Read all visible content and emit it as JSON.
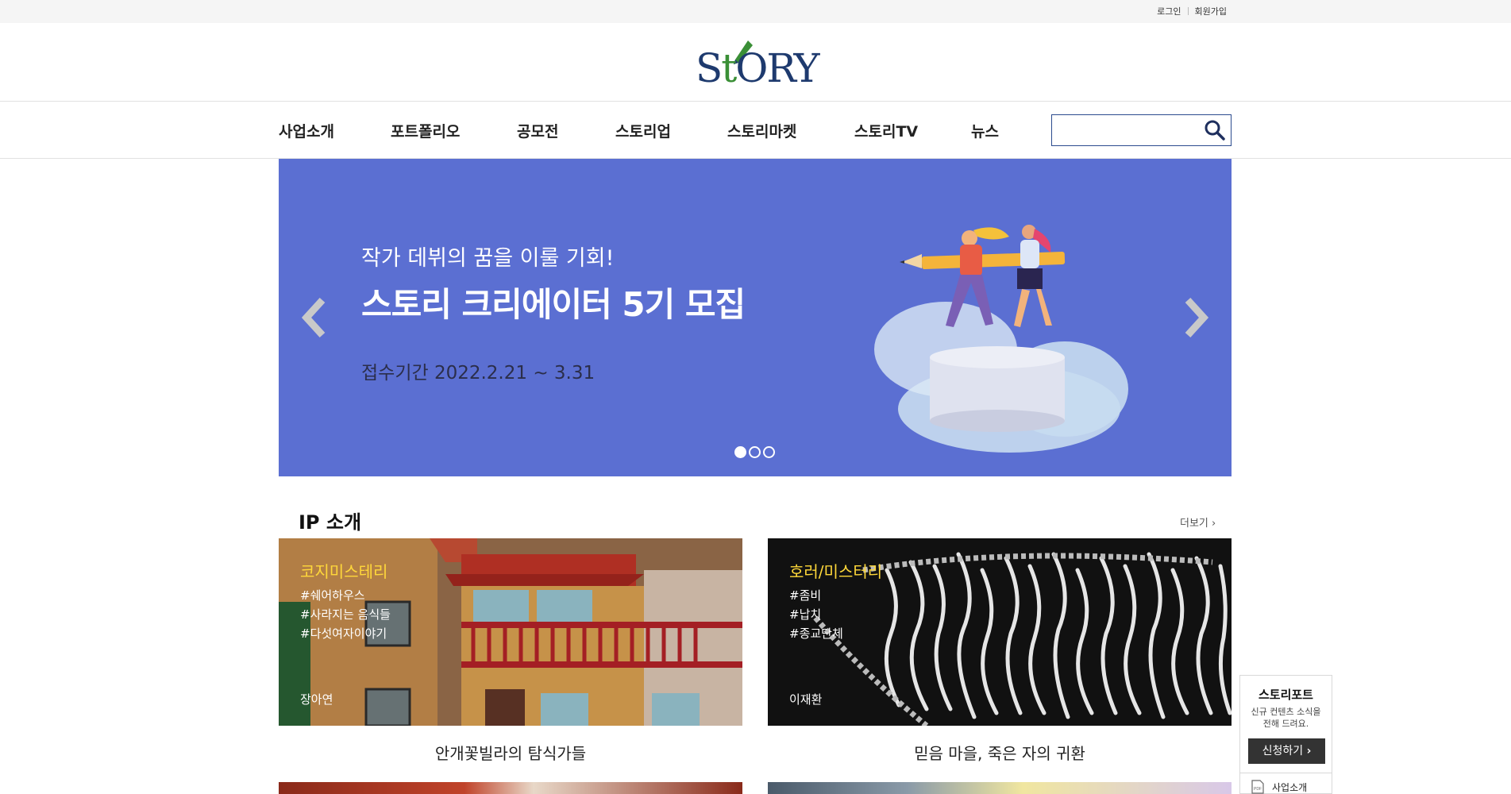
{
  "top_links": {
    "login": "로그인",
    "signup": "회원가입"
  },
  "logo": {
    "text_prefix": "S",
    "text_t": "t",
    "text_suffix": "ORY"
  },
  "nav": {
    "items": [
      "사업소개",
      "포트폴리오",
      "공모전",
      "스토리업",
      "스토리마켓",
      "스토리TV",
      "뉴스"
    ],
    "search_value": ""
  },
  "banner": {
    "subtitle": "작가 데뷔의 꿈을 이룰 기회!",
    "title": "스토리 크리에이터 5기 모집",
    "period": "접수기간 2022.2.21 ~ 3.31",
    "slide_count": 3,
    "active_slide": 1,
    "bg_color": "#5b6fd2"
  },
  "ip_section": {
    "title": "IP 소개",
    "more": "더보기 ›",
    "cards": [
      {
        "genre": "코지미스테리",
        "tags": [
          "#쉐어하우스",
          "#사라지는 음식들",
          "#다섯여자이야기"
        ],
        "author": "장아연",
        "title": "안개꽃빌라의 탐식가들"
      },
      {
        "genre": "호러/미스터리",
        "tags": [
          "#좀비",
          "#납치",
          "#종교단체"
        ],
        "author": "이재환",
        "title": "믿음 마을, 죽은 자의 귀환"
      }
    ]
  },
  "storyport": {
    "title": "스토리포트",
    "desc_line1": "신규 컨텐츠 소식을",
    "desc_line2": "전해 드려요.",
    "apply": "신청하기",
    "intro": "사업소개",
    "pdf_label": "PDF"
  },
  "icons": {
    "search": "search-icon",
    "prev": "chevron-left-icon",
    "next": "chevron-right-icon",
    "apply_arrow": "chevron-right-icon",
    "pdf": "pdf-file-icon"
  }
}
